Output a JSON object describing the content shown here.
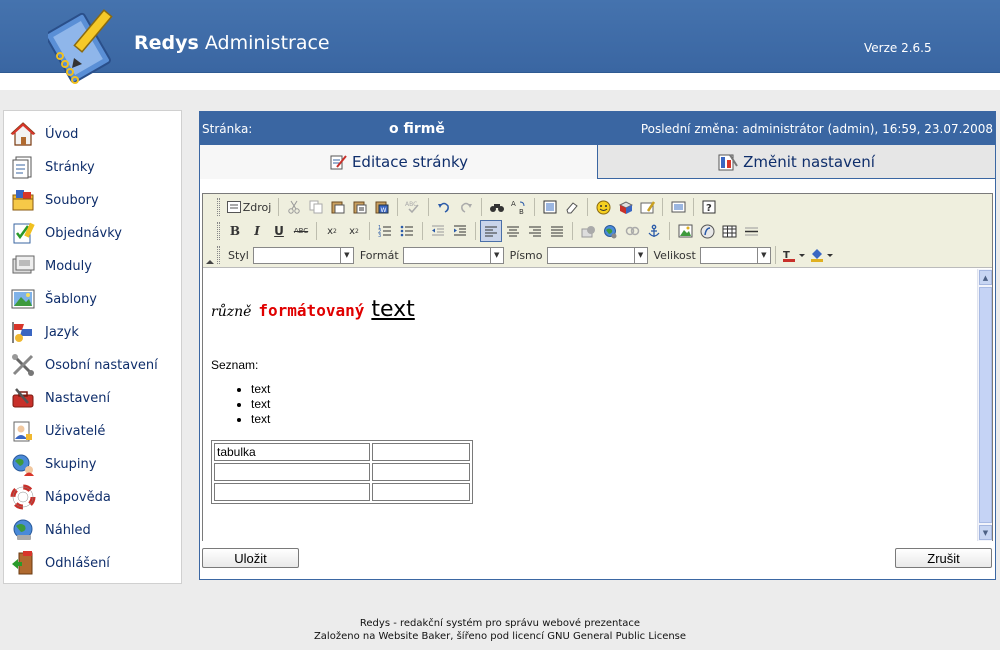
{
  "header": {
    "title_part1": "Redys",
    "title_part2": " Administrace",
    "version": "Verze 2.6.5"
  },
  "sidebar": {
    "items": [
      {
        "label": "Úvod",
        "icon": "home-icon"
      },
      {
        "label": "Stránky",
        "icon": "pages-icon"
      },
      {
        "label": "Soubory",
        "icon": "files-icon"
      },
      {
        "label": "Objednávky",
        "icon": "orders-icon"
      },
      {
        "label": "Moduly",
        "icon": "modules-icon"
      },
      {
        "label": "Šablony",
        "icon": "templates-icon"
      },
      {
        "label": "Jazyk",
        "icon": "language-icon"
      },
      {
        "label": "Osobní nastavení",
        "icon": "personal-settings-icon"
      },
      {
        "label": "Nastavení",
        "icon": "settings-icon"
      },
      {
        "label": "Uživatelé",
        "icon": "users-icon"
      },
      {
        "label": "Skupiny",
        "icon": "groups-icon"
      },
      {
        "label": "Nápověda",
        "icon": "help-icon"
      },
      {
        "label": "Náhled",
        "icon": "preview-icon"
      },
      {
        "label": "Odhlášení",
        "icon": "logout-icon"
      }
    ]
  },
  "info": {
    "label": "Stránka:",
    "page_name": "o firmě",
    "last_change": "Poslední změna: administrátor (admin), 16:59, 23.07.2008"
  },
  "tabs": {
    "edit": "Editace stránky",
    "settings": "Změnit nastavení"
  },
  "toolbar": {
    "source_label": "Zdroj",
    "style_label": "Styl",
    "format_label": "Formát",
    "font_label": "Písmo",
    "size_label": "Velikost",
    "bold": "B",
    "italic": "I",
    "underline": "U",
    "strike": "ABC"
  },
  "content": {
    "word1": "různě",
    "word2": "formátovaný",
    "word3": "text",
    "list_title": "Seznam:",
    "list_items": [
      "text",
      "text",
      "text"
    ],
    "table": [
      [
        "tabulka",
        ""
      ],
      [
        "",
        ""
      ],
      [
        "",
        ""
      ]
    ]
  },
  "buttons": {
    "save": "Uložit",
    "cancel": "Zrušit"
  },
  "footer": {
    "line1": "Redys - redakční systém pro správu webové prezentace",
    "line2": "Založeno na Website Baker, šířeno pod licencí GNU General Public License"
  },
  "colors": {
    "header_blue": "#3a66a2",
    "nav_text": "#0f2e6b",
    "accent_red": "#e00000"
  }
}
